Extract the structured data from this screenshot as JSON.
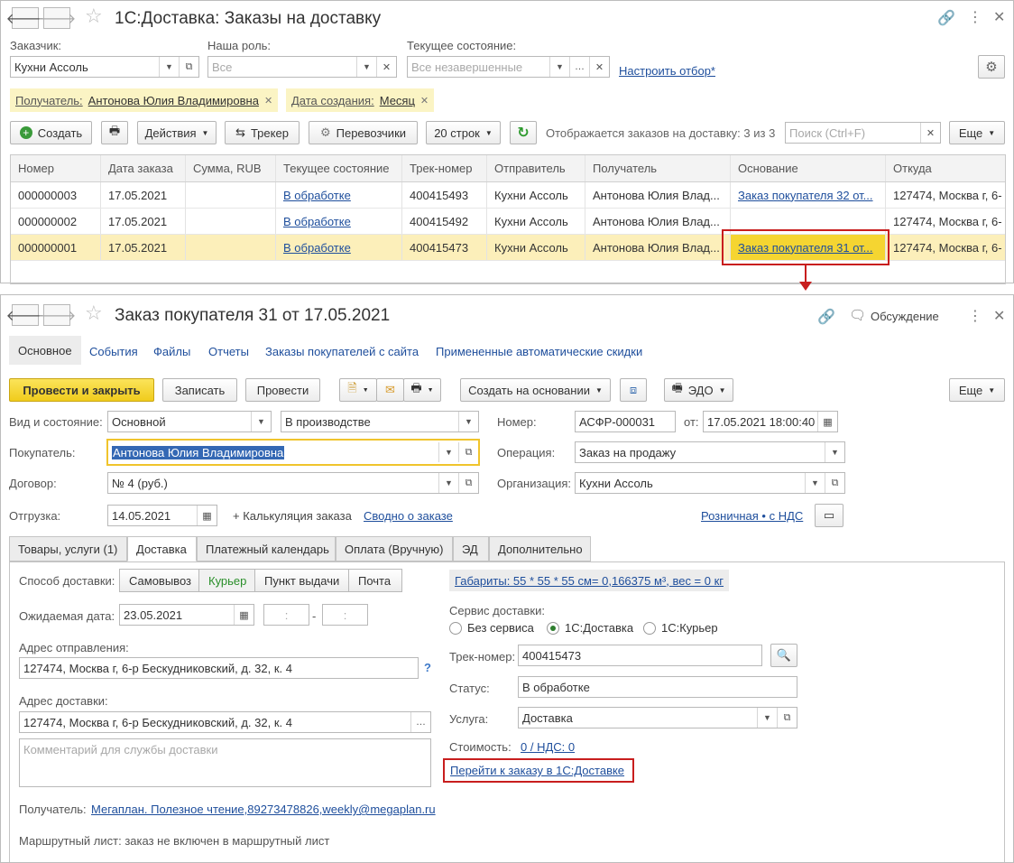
{
  "top_window": {
    "title": "1С:Доставка: Заказы на доставку",
    "filters": {
      "customer_label": "Заказчик:",
      "customer_value": "Кухни Ассоль",
      "role_label": "Наша роль:",
      "role_placeholder": "Все",
      "state_label": "Текущее состояние:",
      "state_placeholder": "Все незавершенные",
      "setup_filter_link": "Настроить отбор*"
    },
    "chips": [
      {
        "key": "Получатель:",
        "value": "Антонова Юлия Владимировна"
      },
      {
        "key": "Дата создания:",
        "value": "Месяц"
      }
    ],
    "toolbar": {
      "create": "Создать",
      "actions": "Действия",
      "tracker": "Трекер",
      "carriers": "Перевозчики",
      "rows": "20 строк",
      "status_text": "Отображается заказов на доставку: 3 из 3",
      "search_placeholder": "Поиск (Ctrl+F)",
      "more": "Еще"
    },
    "table": {
      "headers": [
        "Номер",
        "Дата заказа",
        "Сумма, RUB",
        "Текущее состояние",
        "Трек-номер",
        "Отправитель",
        "Получатель",
        "Основание",
        "Откуда"
      ],
      "rows": [
        [
          "000000003",
          "17.05.2021",
          "",
          "В обработке",
          "400415493",
          "Кухни Ассоль",
          "Антонова Юлия Влад...",
          "Заказ покупателя 32 от...",
          "127474, Москва г, 6-"
        ],
        [
          "000000002",
          "17.05.2021",
          "",
          "В обработке",
          "400415492",
          "Кухни Ассоль",
          "Антонова Юлия Влад...",
          "",
          "127474, Москва г, 6-"
        ],
        [
          "000000001",
          "17.05.2021",
          "",
          "В обработке",
          "400415473",
          "Кухни Ассоль",
          "Антонова Юлия Влад...",
          "Заказ покупателя 31 от...",
          "127474, Москва г, 6-"
        ]
      ]
    }
  },
  "bottom_window": {
    "title": "Заказ покупателя 31 от 17.05.2021",
    "discussion": "Обсуждение",
    "nav": [
      "Основное",
      "События",
      "Файлы",
      "Отчеты",
      "Заказы покупателей с сайта",
      "Примененные автоматические скидки"
    ],
    "toolbar": {
      "post_close": "Провести и закрыть",
      "save": "Записать",
      "post": "Провести",
      "create_based": "Создать на основании",
      "edo": "ЭДО",
      "more": "Еще"
    },
    "form": {
      "kind_label": "Вид и состояние:",
      "kind_value": "Основной",
      "state_value": "В производстве",
      "number_label": "Номер:",
      "number_value": "АСФР-000031",
      "from_label": "от:",
      "date_value": "17.05.2021 18:00:40",
      "buyer_label": "Покупатель:",
      "buyer_value": "Антонова Юлия Владимировна",
      "operation_label": "Операция:",
      "operation_value": "Заказ на продажу",
      "contract_label": "Договор:",
      "contract_value": "№ 4 (руб.)",
      "org_label": "Организация:",
      "org_value": "Кухни Ассоль",
      "shipment_label": "Отгрузка:",
      "shipment_value": "14.05.2021",
      "calc_text": "+ Калькуляция заказа",
      "summary_link": "Сводно о заказе",
      "price_link": "Розничная • с НДС"
    },
    "tabs": [
      "Товары, услуги (1)",
      "Доставка",
      "Платежный календарь",
      "Оплата (Вручную)",
      "ЭД",
      "Дополнительно"
    ],
    "delivery": {
      "method_label": "Способ доставки:",
      "methods": [
        "Самовывоз",
        "Курьер",
        "Пункт выдачи",
        "Почта"
      ],
      "expected_label": "Ожидаемая дата:",
      "expected_value": "23.05.2021",
      "time_placeholder": ":",
      "dash": "-",
      "from_addr_label": "Адрес отправления:",
      "from_addr_value": "127474, Москва г, 6-р Бескудниковский, д. 32, к. 4",
      "help": "?",
      "to_addr_label": "Адрес доставки:",
      "to_addr_value": "127474, Москва г, 6-р Бескудниковский, д. 32, к. 4",
      "comment_placeholder": "Комментарий для службы доставки",
      "recipient_label": "Получатель:",
      "recipient_link": "Мегаплан. Полезное чтение,89273478826,weekly@megaplan.ru",
      "route_text": "Маршрутный лист: заказ не включен в маршрутный лист",
      "dims_link": "Габариты: 55 * 55 * 55 см= 0,166375 м³, вес = 0 кг",
      "service_label": "Сервис доставки:",
      "services": [
        "Без сервиса",
        "1С:Доставка",
        "1С:Курьер"
      ],
      "track_label": "Трек-номер:",
      "track_value": "400415473",
      "status_label": "Статус:",
      "status_value": "В обработке",
      "service2_label": "Услуга:",
      "service2_value": "Доставка",
      "cost_label": "Стоимость:",
      "cost_link": "0 / НДС: 0",
      "goto_link": "Перейти к заказу в 1С:Доставке"
    }
  },
  "colors": {
    "accent_link": "#1e4e9c",
    "highlight": "#c81e1e",
    "yellow_button": "#f5d531",
    "selected_row": "#fcefba"
  }
}
